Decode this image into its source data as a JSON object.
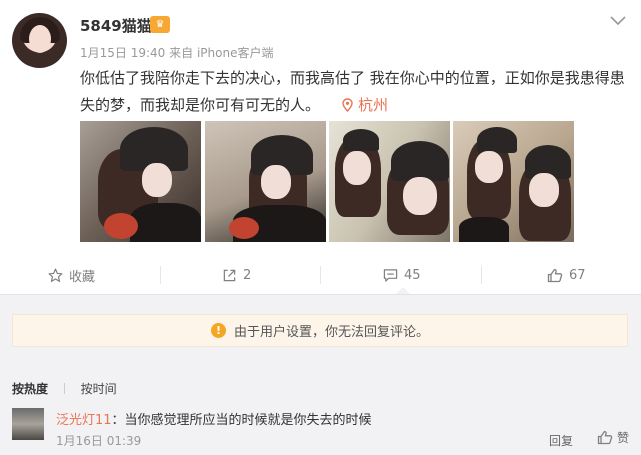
{
  "post": {
    "username": "5849猫猫",
    "vip_badge": "vip",
    "timestamp": "1月15日 19:40",
    "source": "来自 iPhone客户端",
    "text": "你低估了我陪你走下去的决心，而我高估了 我在你心中的位置，正如你是我患得患失的梦，而我却是你可有可无的人。",
    "location": "杭州",
    "images": [
      "photo-1",
      "photo-2",
      "photo-3",
      "photo-4"
    ]
  },
  "actions": {
    "favorite_label": "收藏",
    "share_count": "2",
    "comment_count": "45",
    "like_count": "67"
  },
  "comments": {
    "notice": "由于用户设置，你无法回复评论。",
    "sort_hot": "按热度",
    "sort_time": "按时间",
    "items": [
      {
        "user": "泛光灯11",
        "text": "：当你感觉理所应当的时候就是你失去的时候",
        "time": "1月16日 01:39",
        "reply_label": "回复",
        "like_label": "赞"
      }
    ]
  },
  "colors": {
    "accent": "#eb7350",
    "warning": "#f5a623",
    "notice_bg": "#fdf5ea",
    "comment_bg": "#f2f2f5"
  },
  "icons": [
    "chevron-down-icon",
    "location-pin-icon",
    "star-icon",
    "share-icon",
    "comment-icon",
    "thumbs-up-icon",
    "warning-icon"
  ]
}
